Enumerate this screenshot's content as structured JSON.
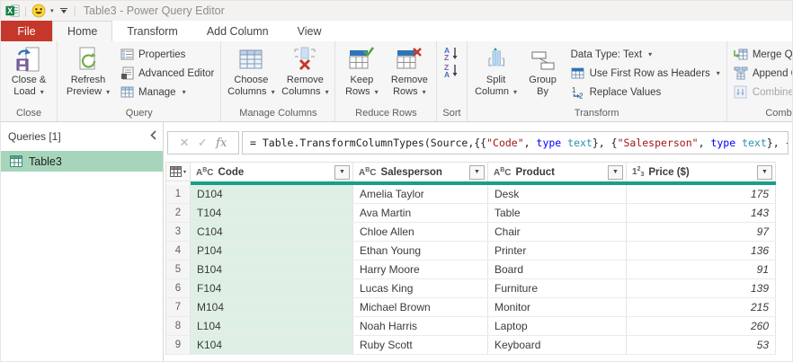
{
  "colors": {
    "file_tab_red": "#c5372b",
    "selection_green": "#a6d5bb",
    "code_column_green": "#def0e4",
    "header_bar_teal": "#1a9e8a"
  },
  "titlebar": {
    "title": "Table3 - Power Query Editor"
  },
  "tabs": {
    "file": "File",
    "home": "Home",
    "transform": "Transform",
    "add_column": "Add Column",
    "view": "View"
  },
  "ribbon": {
    "close_group": {
      "label": "Close",
      "close_load": "Close & Load"
    },
    "query_group": {
      "label": "Query",
      "refresh_preview": "Refresh Preview",
      "properties": "Properties",
      "advanced_editor": "Advanced Editor",
      "manage": "Manage"
    },
    "manage_columns_group": {
      "label": "Manage Columns",
      "choose_columns": "Choose Columns",
      "remove_columns": "Remove Columns"
    },
    "reduce_rows_group": {
      "label": "Reduce Rows",
      "keep_rows": "Keep Rows",
      "remove_rows": "Remove Rows"
    },
    "sort_group": {
      "label": "Sort"
    },
    "transform_group": {
      "label": "Transform",
      "split_column": "Split Column",
      "group_by": "Group By",
      "data_type": "Data Type: Text",
      "use_first_row": "Use First Row as Headers",
      "replace_values": "Replace Values"
    },
    "combine_group": {
      "label": "Combine",
      "merge_queries": "Merge Queries",
      "append_queries": "Append Queries",
      "combine_files": "Combine Files"
    }
  },
  "queries_pane": {
    "header": "Queries [1]",
    "items": [
      {
        "name": "Table3",
        "selected": true
      }
    ]
  },
  "formula_bar": {
    "fx": "fx",
    "segments": [
      {
        "text": "= Table.TransformColumnTypes(Source,{{",
        "cls": "plain"
      },
      {
        "text": "\"Code\"",
        "cls": "str"
      },
      {
        "text": ", ",
        "cls": "plain"
      },
      {
        "text": "type",
        "cls": "kw"
      },
      {
        "text": " ",
        "cls": "plain"
      },
      {
        "text": "text",
        "cls": "typ"
      },
      {
        "text": "}, {",
        "cls": "plain"
      },
      {
        "text": "\"Salesperson\"",
        "cls": "str"
      },
      {
        "text": ", ",
        "cls": "plain"
      },
      {
        "text": "type",
        "cls": "kw"
      },
      {
        "text": " ",
        "cls": "plain"
      },
      {
        "text": "text",
        "cls": "typ"
      },
      {
        "text": "}, {",
        "cls": "plain"
      }
    ]
  },
  "table": {
    "columns": [
      {
        "name": "Code",
        "type": "text"
      },
      {
        "name": "Salesperson",
        "type": "text"
      },
      {
        "name": "Product",
        "type": "text"
      },
      {
        "name": "Price ($)",
        "type": "number"
      }
    ],
    "rows": [
      {
        "num": "1",
        "code": "D104",
        "salesperson": "Amelia Taylor",
        "product": "Desk",
        "price": "175"
      },
      {
        "num": "2",
        "code": "T104",
        "salesperson": "Ava Martin",
        "product": "Table",
        "price": "143"
      },
      {
        "num": "3",
        "code": "C104",
        "salesperson": "Chloe Allen",
        "product": "Chair",
        "price": "97"
      },
      {
        "num": "4",
        "code": "P104",
        "salesperson": "Ethan Young",
        "product": "Printer",
        "price": "136"
      },
      {
        "num": "5",
        "code": "B104",
        "salesperson": "Harry Moore",
        "product": "Board",
        "price": "91"
      },
      {
        "num": "6",
        "code": "F104",
        "salesperson": "Lucas King",
        "product": "Furniture",
        "price": "139"
      },
      {
        "num": "7",
        "code": "M104",
        "salesperson": "Michael Brown",
        "product": "Monitor",
        "price": "215"
      },
      {
        "num": "8",
        "code": "L104",
        "salesperson": "Noah Harris",
        "product": "Laptop",
        "price": "260"
      },
      {
        "num": "9",
        "code": "K104",
        "salesperson": "Ruby Scott",
        "product": "Keyboard",
        "price": "53"
      }
    ]
  }
}
